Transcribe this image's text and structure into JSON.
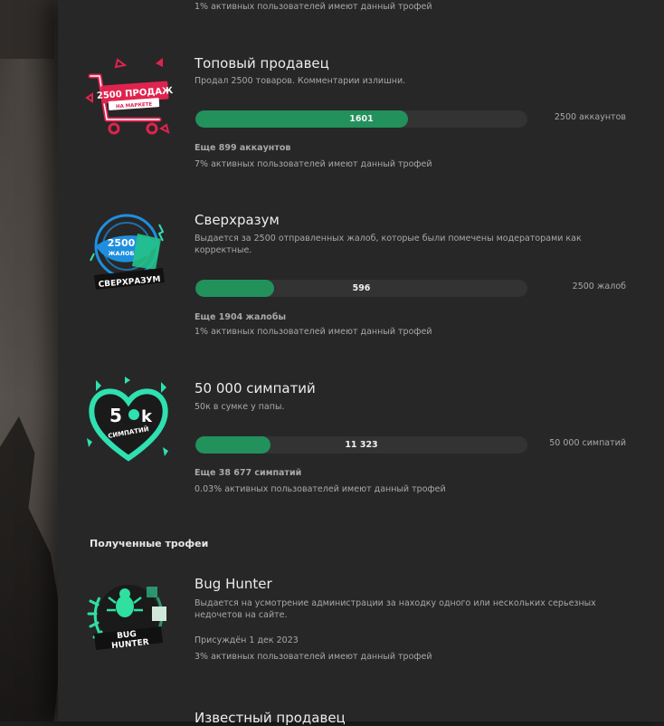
{
  "top_stat": "1% активных пользователей имеют данный трофей",
  "trophies": [
    {
      "title": "Топовый продавец",
      "description": "Продал 2500 товаров. Комментарии излишни.",
      "progress_value": "1601",
      "progress_fraction": 0.64,
      "goal": "2500 аккаунтов",
      "remaining": "Еще 899 аккаунтов",
      "stat": "7% активных пользователей имеют данный трофей",
      "badge": {
        "icon": "cart-icon",
        "line1": "2500 ПРОДАЖ",
        "line2": "НА МАРКЕТЕ",
        "color": "#e0234e"
      }
    },
    {
      "title": "Сверхразум",
      "description": "Выдается за 2500 отправленных жалоб, которые были помечены модераторами как корректные.",
      "progress_value": "596",
      "progress_fraction": 0.238,
      "goal": "2500 жалоб",
      "remaining": "Еще 1904 жалобы",
      "stat": "1% активных пользователей имеют данный трофей",
      "badge": {
        "icon": "brain-globe-icon",
        "line1": "2500",
        "line2": "ЖАЛОБ",
        "line3": "СВЕРХРАЗУМ",
        "color": "#1e8fe0"
      }
    },
    {
      "title": "50 000 симпатий",
      "description": "50к в сумке у папы.",
      "progress_value": "11 323",
      "progress_fraction": 0.226,
      "goal": "50 000 симпатий",
      "remaining": "Еще 38 677 симпатий",
      "stat": "0.03% активных пользователей имеют данный трофей",
      "badge": {
        "icon": "heart-icon",
        "line1": "5",
        "line1b": "k",
        "line2": "СИМПАТИЙ",
        "color": "#2fe0b0"
      }
    }
  ],
  "received_section_title": "Полученные трофеи",
  "received": [
    {
      "title": "Bug Hunter",
      "description": "Выдается на усмотрение администрации за находку одного или нескольких серьезных недочетов на сайте.",
      "awarded": "Присуждён 1 дек 2023",
      "stat": "3% активных пользователей имеют данный трофей",
      "badge": {
        "icon": "bug-icon",
        "line1": "BUG",
        "line2": "HUNTER",
        "color": "#2fe0a0"
      }
    },
    {
      "title": "Известный продавец"
    }
  ]
}
